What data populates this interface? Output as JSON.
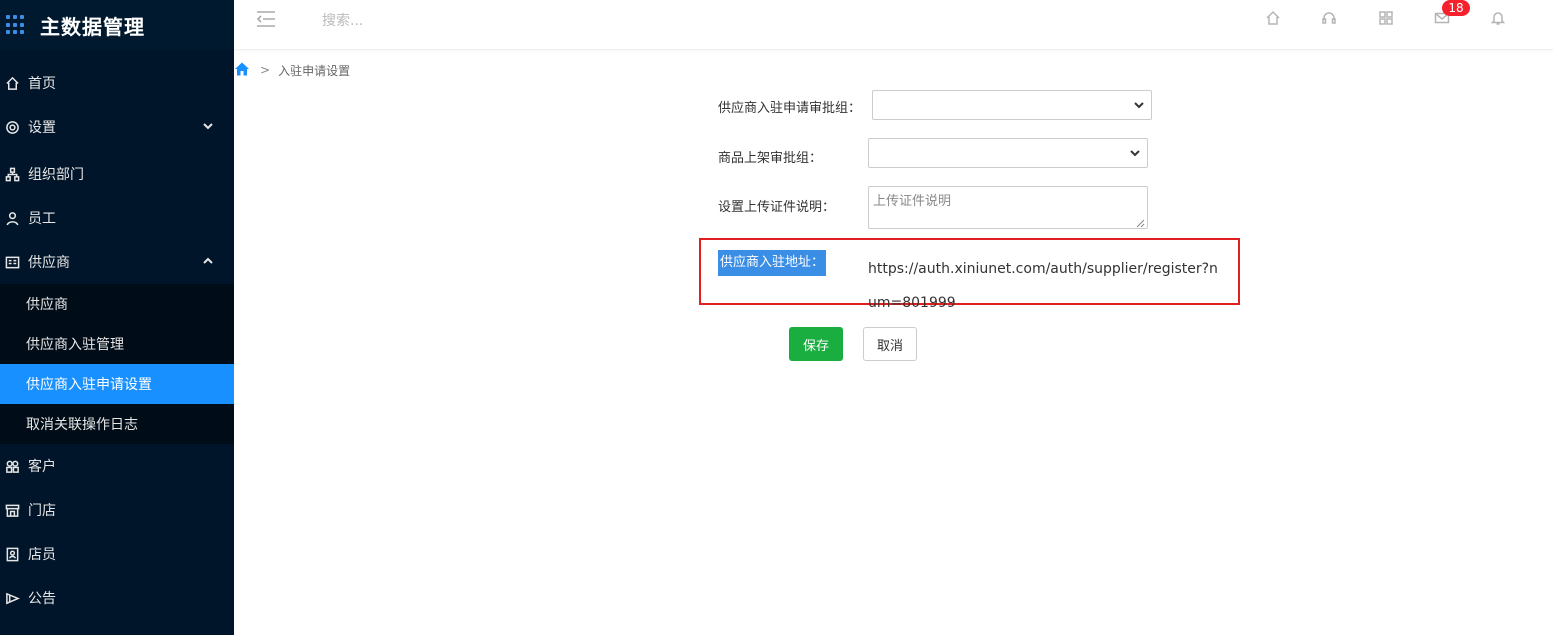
{
  "app": {
    "title": "主数据管理"
  },
  "sidebar": {
    "items": [
      {
        "label": "首页"
      },
      {
        "label": "设置"
      },
      {
        "label": "组织部门"
      },
      {
        "label": "员工"
      },
      {
        "label": "供应商"
      },
      {
        "label": "客户"
      },
      {
        "label": "门店"
      },
      {
        "label": "店员"
      },
      {
        "label": "公告"
      }
    ],
    "supplier_sub": [
      {
        "label": "供应商"
      },
      {
        "label": "供应商入驻管理"
      },
      {
        "label": "供应商入驻申请设置"
      },
      {
        "label": "取消关联操作日志"
      }
    ]
  },
  "header": {
    "search_placeholder": "搜索...",
    "mail_badge": "18"
  },
  "breadcrumb": {
    "current": "入驻申请设置"
  },
  "form": {
    "approval_group_label": "供应商入驻申请审批组：",
    "approval_group_value": "",
    "listing_group_label": "商品上架审批组：",
    "listing_group_value": "",
    "upload_desc_label": "设置上传证件说明：",
    "upload_desc_placeholder": "上传证件说明",
    "url_label": "供应商入驻地址：",
    "url_value": "https://auth.xiniunet.com/auth/supplier/register?num=801999",
    "save_label": "保存",
    "cancel_label": "取消"
  },
  "colors": {
    "sidebar_bg": "#001529",
    "active": "#1890ff",
    "save": "#1aad40",
    "badge": "#f5222d",
    "highlight_border": "#e02020"
  }
}
